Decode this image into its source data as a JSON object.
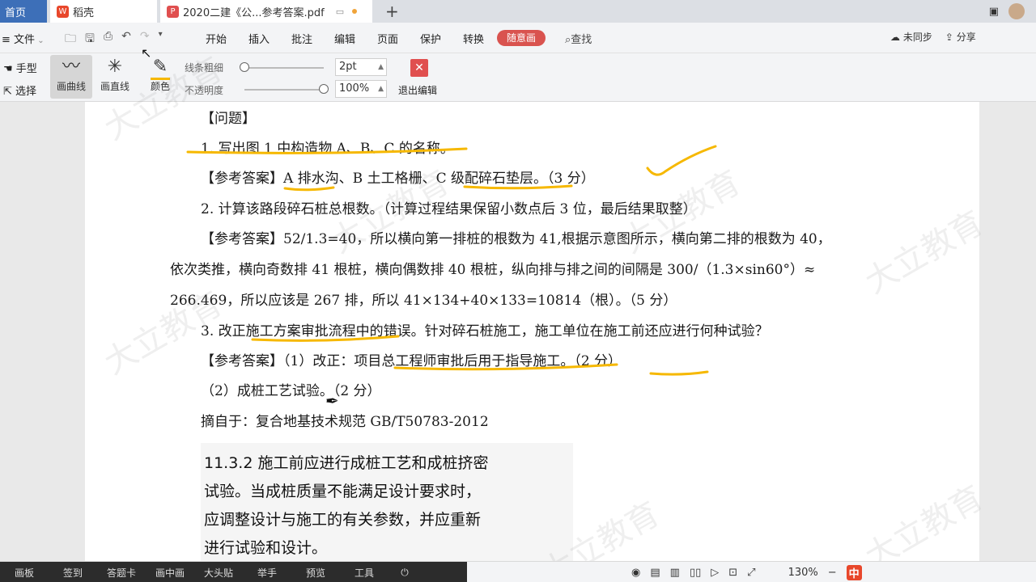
{
  "tabs": {
    "home": "首页",
    "daoke": "稻壳",
    "pdf": "2020二建《公...参考答案.pdf"
  },
  "menu": {
    "file": "文件",
    "items": [
      "开始",
      "插入",
      "批注",
      "编辑",
      "页面",
      "保护",
      "转换"
    ],
    "active": "随意画",
    "search": "查找",
    "right_items": [
      "未同步",
      "分享"
    ]
  },
  "pen_toolbar": {
    "hand": "手型",
    "select": "选择",
    "curve": "画曲线",
    "line": "画直线",
    "color": "颜色",
    "line_width_label": "线条粗细",
    "line_width_value": "2pt",
    "opacity_label": "不透明度",
    "opacity_value": "100%",
    "exit": "退出编辑",
    "line_width_level": 0.0,
    "opacity_level": 1.0
  },
  "document": {
    "lines": [
      "【问题】",
      "1. 写出图 1 中构造物 A、B、C 的名称。",
      "【参考答案】A 排水沟、B 土工格栅、C 级配碎石垫层。（3 分）",
      "2. 计算该路段碎石桩总根数。（计算过程结果保留小数点后 3 位，最后结果取整）",
      "【参考答案】52/1.3=40，所以横向第一排桩的根数为 41,根据示意图所示，横向第二排的根数为 40，",
      "依次类推，横向奇数排 41 根桩，横向偶数排 40 根桩，纵向排与排之间的间隔是 300/（1.3×sin60°）≈",
      "266.469，所以应该是 267 排，所以 41×134+40×133=10814（根）。（5 分）",
      "3. 改正施工方案审批流程中的错误。针对碎石桩施工，施工单位在施工前还应进行何种试验？",
      "【参考答案】（1）改正：项目总工程师审批后用于指导施工。（2 分）",
      "（2）成桩工艺试验。（2 分）",
      "摘自于：复合地基技术规范 GB/T50783-2012"
    ],
    "excerpt": [
      "11.3.2 施工前应进行成桩工艺和成桩挤密",
      "试验。当成桩质量不能满足设计要求时，",
      "应调整设计与施工的有关参数，并应重新",
      "进行试验和设计。"
    ]
  },
  "watermark": "大立教育",
  "live_tools": [
    "画板",
    "签到",
    "答题卡",
    "画中画",
    "大头贴",
    "举手",
    "预览",
    "工具"
  ],
  "status": {
    "zoom": "130%",
    "ime": "中"
  },
  "colors": {
    "highlighter": "#f6b800",
    "active_tab": "#3d6fb8",
    "active_menu": "#d9534f",
    "exit_button": "#e04f4f"
  }
}
